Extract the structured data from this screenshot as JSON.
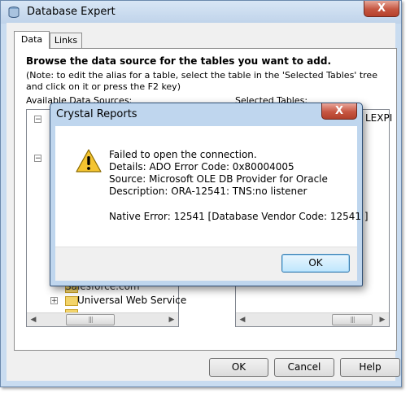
{
  "expert_window": {
    "title": "Database Expert",
    "close_glyph": "X",
    "tabs": [
      {
        "label": "Data"
      },
      {
        "label": "Links"
      }
    ],
    "heading": "Browse the data source for the tables you want to add.",
    "note": "(Note: to edit the alias for a table, select the table in the 'Selected Tables' tree and click on it or press the F2 key)",
    "available_label": "Available Data Sources:",
    "selected_label": "Selected Tables:",
    "tree_items": [
      "Salesforce.com",
      "Universal Web Service"
    ],
    "selected_items": [
      "LEXPI"
    ],
    "buttons": {
      "ok": "OK",
      "cancel": "Cancel",
      "help": "Help"
    }
  },
  "dialog": {
    "title": "Crystal Reports",
    "close_glyph": "X",
    "message": {
      "line1": "Failed to open the connection.",
      "line2": "Details: ADO Error Code: 0x80004005",
      "line3": "Source: Microsoft OLE DB Provider for Oracle",
      "line4": "Description: ORA-12541: TNS:no listener",
      "native": "Native Error: 12541 [Database Vendor Code: 12541 ]"
    },
    "ok_label": "OK",
    "icon": "warning-icon"
  },
  "colors": {
    "window_frame": "#c9dcf0",
    "close_button": "#c55641",
    "warning_yellow": "#f4c430",
    "default_button": "#bee6fd"
  }
}
